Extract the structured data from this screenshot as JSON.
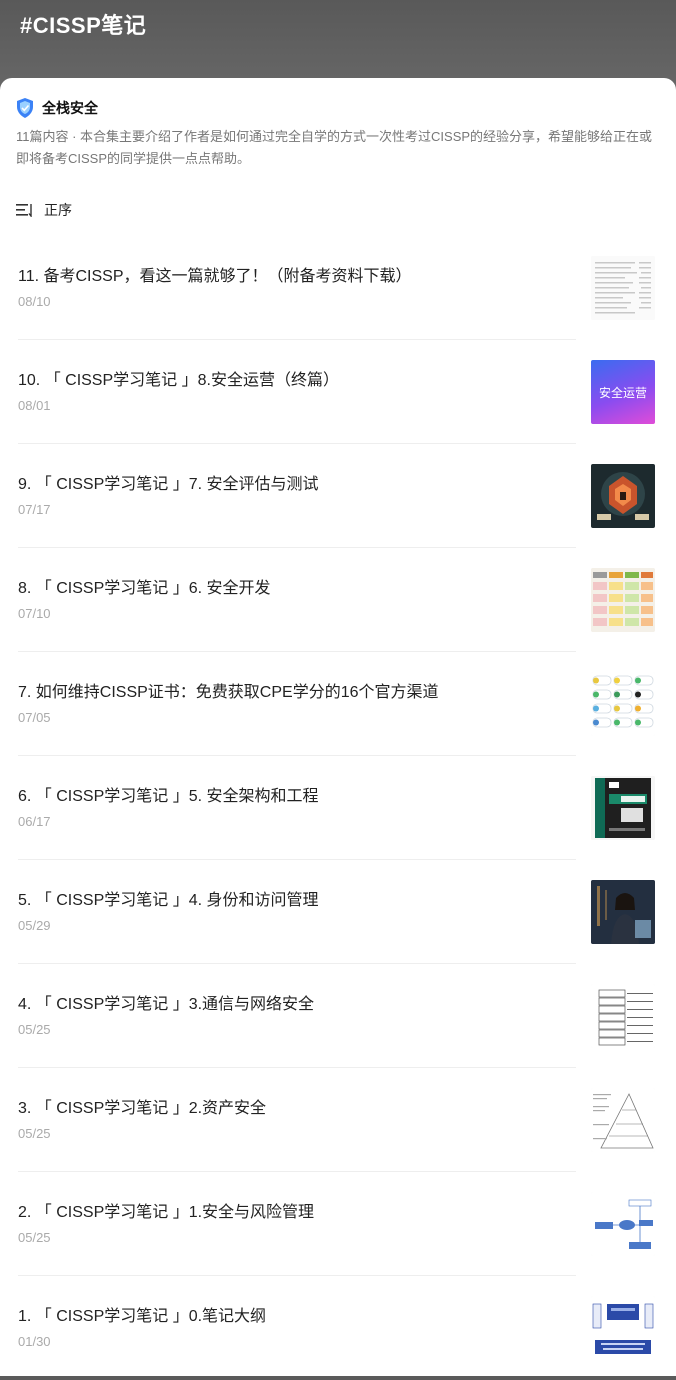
{
  "header": {
    "title": "#CISSP笔记"
  },
  "account": {
    "name": "全栈安全"
  },
  "collection": {
    "description": "11篇内容 · 本合集主要介绍了作者是如何通过完全自学的方式一次性考过CISSP的经验分享，希望能够给正在或即将备考CISSP的同学提供一点点帮助。",
    "sort_label": "正序"
  },
  "articles": [
    {
      "title": "11. 备考CISSP，看这一篇就够了！（附备考资料下载）",
      "date": "08/10",
      "thumb": "document-screenshot"
    },
    {
      "title": "10. 「 CISSP学习笔记 」8.安全运营（终篇）",
      "date": "08/01",
      "thumb": "gradient-card",
      "thumb_text": "安全运营"
    },
    {
      "title": "9. 「 CISSP学习笔记 」7. 安全评估与测试",
      "date": "07/17",
      "thumb": "security-art"
    },
    {
      "title": "8. 「 CISSP学习笔记 」6. 安全开发",
      "date": "07/10",
      "thumb": "color-grid"
    },
    {
      "title": "7. 如何维持CISSP证书：免费获取CPE学分的16个官方渠道",
      "date": "07/05",
      "thumb": "badge-list"
    },
    {
      "title": "6. 「 CISSP学习笔记 」5. 安全架构和工程",
      "date": "06/17",
      "thumb": "book-cover"
    },
    {
      "title": "5. 「 CISSP学习笔记 」4. 身份和访问管理",
      "date": "05/29",
      "thumb": "person-photo"
    },
    {
      "title": "4. 「 CISSP学习笔记 」3.通信与网络安全",
      "date": "05/25",
      "thumb": "osi-layers"
    },
    {
      "title": "3. 「 CISSP学习笔记 」2.资产安全",
      "date": "05/25",
      "thumb": "pyramid-diagram"
    },
    {
      "title": "2. 「 CISSP学习笔记 」1.安全与风险管理",
      "date": "05/25",
      "thumb": "flow-diagram"
    },
    {
      "title": "1. 「 CISSP学习笔记 」0.笔记大纲",
      "date": "01/30",
      "thumb": "outline-diagram"
    }
  ],
  "colors": {
    "accent": "#3b82f6",
    "header_bg": "#5c5c5c"
  }
}
